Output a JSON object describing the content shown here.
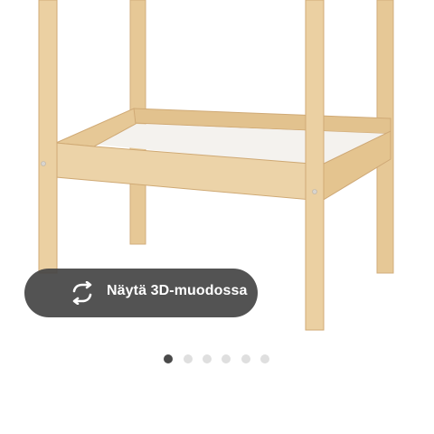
{
  "view_3d": {
    "label": "Näytä 3D-muodossa",
    "icon": "rotate-arrows-icon"
  },
  "product_image": {
    "subject": "changing-table-icon"
  },
  "carousel": {
    "slide_count": 6,
    "active_index": 0
  },
  "colors": {
    "wood": "#e8cc9e",
    "wood_edge": "#cda875",
    "overlay": "#464646",
    "dot_active": "#4a4a4a",
    "dot_inactive": "#dfdfdf"
  }
}
